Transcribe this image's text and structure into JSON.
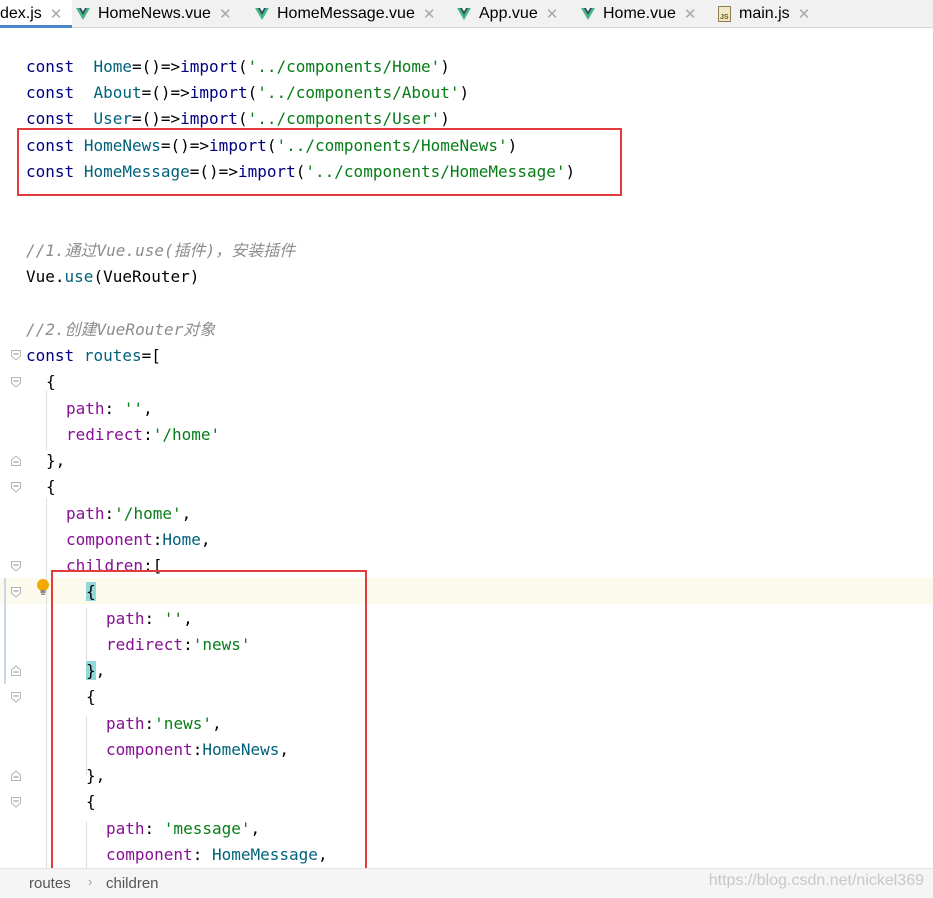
{
  "tabs": [
    {
      "label": "dex.js",
      "icon": "js-file-icon",
      "active": true
    },
    {
      "label": "HomeNews.vue",
      "icon": "vue-icon",
      "active": false
    },
    {
      "label": "HomeMessage.vue",
      "icon": "vue-icon",
      "active": false
    },
    {
      "label": "App.vue",
      "icon": "vue-icon",
      "active": false
    },
    {
      "label": "Home.vue",
      "icon": "vue-icon",
      "active": false
    },
    {
      "label": "main.js",
      "icon": "js-file-icon",
      "active": false
    }
  ],
  "close_glyph": "✕",
  "code": {
    "l1": {
      "kw": "const",
      "sp": "  ",
      "name": "Home",
      "a": "=()=>",
      "imp": "import",
      "b": "(",
      "str": "'../components/Home'",
      "c": ")"
    },
    "l2": {
      "kw": "const",
      "sp": "  ",
      "name": "About",
      "a": "=()=>",
      "imp": "import",
      "b": "(",
      "str": "'../components/About'",
      "c": ")"
    },
    "l3": {
      "kw": "const",
      "sp": "  ",
      "name": "User",
      "a": "=()=>",
      "imp": "import",
      "b": "(",
      "str": "'../components/User'",
      "c": ")"
    },
    "l4": {
      "kw": "const",
      "sp": " ",
      "name": "HomeNews",
      "a": "=()=>",
      "imp": "import",
      "b": "(",
      "str": "'../components/HomeNews'",
      "c": ")"
    },
    "l5": {
      "kw": "const",
      "sp": " ",
      "name": "HomeMessage",
      "a": "=()=>",
      "imp": "import",
      "b": "(",
      "str": "'../components/HomeMessage'",
      "c": ")"
    },
    "comment1": "//1.通过Vue.use(插件)，安装插件",
    "use": {
      "obj": "Vue.",
      "method": "use",
      "args": "(VueRouter)"
    },
    "comment2": "//2.创建VueRouter对象",
    "routes_decl": {
      "kw": "const",
      "sp": " ",
      "name": "routes",
      "rest": "=["
    },
    "open_brace": "{",
    "close_brace_comma": "},",
    "close_brace": "}",
    "comma": ",",
    "path_key": "path",
    "redirect_key": "redirect",
    "component_key": "component",
    "children_key": "children",
    "colon": ":",
    "colon_space": ": ",
    "empty_str": "''",
    "home_path": "'/home'",
    "news_str": "'news'",
    "message_str": "'message'",
    "home_comp": "Home",
    "homenews_comp": "HomeNews",
    "homemessage_comp": "HomeMessage",
    "bracket_open": "["
  },
  "breadcrumb": [
    "routes",
    "children"
  ],
  "breadcrumb_sep": "›",
  "watermark": "https://blog.csdn.net/nickel369",
  "colors": {
    "keyword": "#000080",
    "string": "#067d17",
    "identifier": "#00627a",
    "property": "#871094",
    "comment": "#8c8c8c",
    "annotation_box": "#e6393b",
    "brace_highlight": "#93d9d9"
  }
}
